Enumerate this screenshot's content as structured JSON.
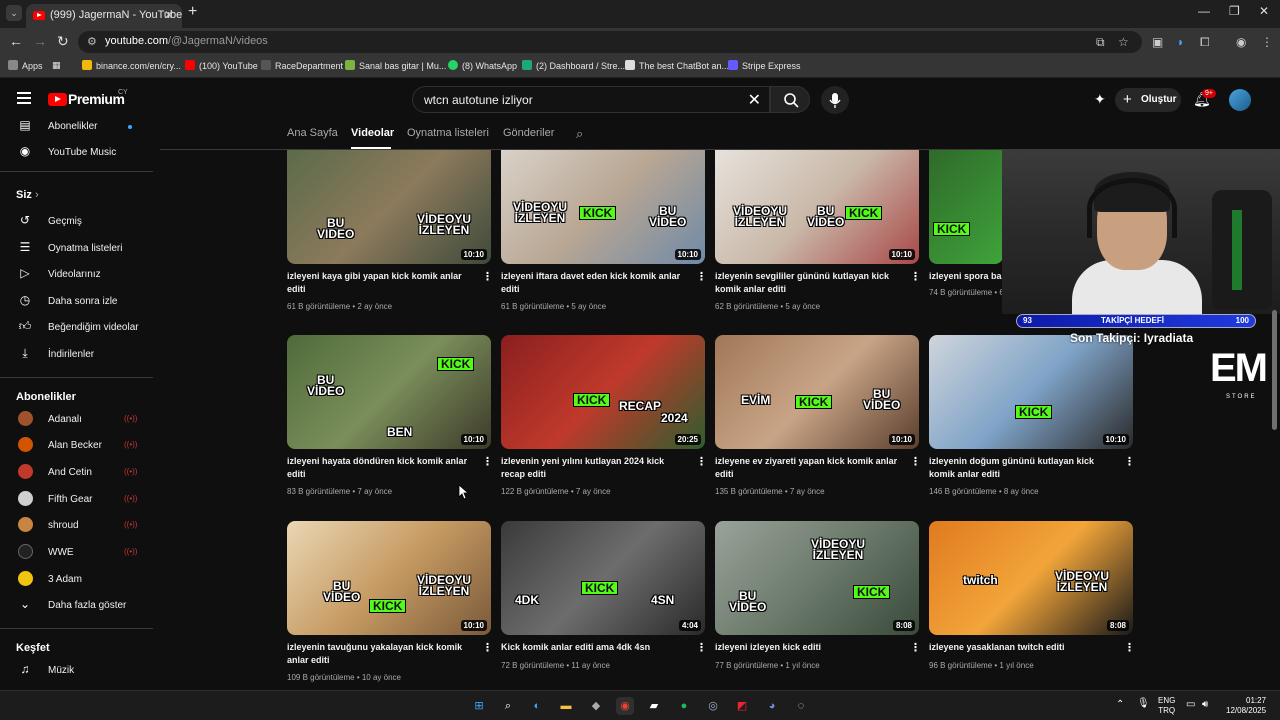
{
  "browser": {
    "tab_title": "(999) JagermaN - YouTube",
    "url_host": "youtube.com",
    "url_path": "/@JagermaN/videos",
    "bookmarks": [
      {
        "label": "Apps",
        "color": "#888888"
      },
      {
        "label": "binance.com/en/cry...",
        "color": "#f0b90b"
      },
      {
        "label": "(100) YouTube",
        "color": "#ff0000"
      },
      {
        "label": "RaceDepartment",
        "color": "#555555"
      },
      {
        "label": "Sanal bas gitar | Mu...",
        "color": "#7cb342"
      },
      {
        "label": "(8) WhatsApp",
        "color": "#25d366"
      },
      {
        "label": "(2) Dashboard / Stre...",
        "color": "#1fa67a"
      },
      {
        "label": "The best ChatBot an...",
        "color": "#dddddd"
      },
      {
        "label": "Stripe Express",
        "color": "#635bff"
      }
    ]
  },
  "yt": {
    "brand": "Premium",
    "country": "CY",
    "search_query": "wtcn autotune izliyor",
    "create_label": "Oluştur",
    "notif_count": "9+"
  },
  "sidebar": {
    "top": [
      {
        "label": "Abonelikler",
        "icon": "subscriptions-icon"
      },
      {
        "label": "YouTube Music",
        "icon": "music-icon"
      }
    ],
    "you_heading": "Siz",
    "you_items": [
      {
        "label": "Geçmiş",
        "icon": "history-icon"
      },
      {
        "label": "Oynatma listeleri",
        "icon": "playlists-icon"
      },
      {
        "label": "Videolarınız",
        "icon": "your-videos-icon"
      },
      {
        "label": "Daha sonra izle",
        "icon": "watch-later-icon"
      },
      {
        "label": "Beğendiğim videolar",
        "icon": "liked-icon"
      },
      {
        "label": "İndirilenler",
        "icon": "download-icon"
      }
    ],
    "subs_heading": "Abonelikler",
    "subs": [
      {
        "label": "Adanalı",
        "color": "#a0522d",
        "live": true
      },
      {
        "label": "Alan Becker",
        "color": "#d35400",
        "live": true
      },
      {
        "label": "And Cetin",
        "color": "#c0392b",
        "live": true
      },
      {
        "label": "Fifth Gear",
        "color": "#cfcfcf",
        "live": true
      },
      {
        "label": "shroud",
        "color": "#c68642",
        "live": true
      },
      {
        "label": "WWE",
        "color": "#222222",
        "live": true
      },
      {
        "label": "3 Adam",
        "color": "#f1c40f",
        "live": false
      }
    ],
    "show_more": "Daha fazla göster",
    "explore_heading": "Keşfet",
    "explore_items": [
      {
        "label": "Müzik",
        "icon": "music-note-icon"
      }
    ]
  },
  "channel_tabs": [
    "Ana Sayfa",
    "Videolar",
    "Oynatma listeleri",
    "Gönderiler"
  ],
  "videos": [
    {
      "title": "izleyeni kaya gibi yapan kick komik anlar editi",
      "views": "61 B görüntüleme",
      "age": "2 ay önce",
      "duration": "10:10",
      "bg": "linear-gradient(135deg,#5b6b4a,#8c7a5c 50%,#3e4a3a)"
    },
    {
      "title": "izleyeni iftara davet eden kick komik anlar editi",
      "views": "61 B görüntüleme",
      "age": "5 ay önce",
      "duration": "10:10",
      "bg": "linear-gradient(135deg,#d9d2c9,#b8a693 50%,#6f8aa8)"
    },
    {
      "title": "izleyenin sevgililer gününü kutlayan kick komik anlar editi",
      "views": "62 B görüntüleme",
      "age": "5 ay önce",
      "duration": "10:10",
      "bg": "linear-gradient(135deg,#e6e2dc,#c9b8a8 50%,#a84848)"
    },
    {
      "title": "izleyeni spora baş",
      "views": "74 B görüntüleme",
      "age": "6",
      "duration": "",
      "bg": "linear-gradient(135deg,#2f6a2a,#3fa33a)"
    },
    {
      "title": "izleyeni hayata döndüren kick komik anlar editi",
      "views": "83 B görüntüleme",
      "age": "7 ay önce",
      "duration": "10:10",
      "bg": "linear-gradient(135deg,#4f6b3a,#7a8e5a 50%,#3d3a2a)"
    },
    {
      "title": "izlevenin yeni yılını kutlayan 2024 kick recap editi",
      "views": "122 B görüntüleme",
      "age": "7 ay önce",
      "duration": "20:25",
      "bg": "linear-gradient(135deg,#8a1f1f,#c0392b 50%,#2e5d2e)"
    },
    {
      "title": "izleyene ev ziyareti yapan kick komik anlar editi",
      "views": "135 B görüntüleme",
      "age": "7 ay önce",
      "duration": "10:10",
      "bg": "linear-gradient(135deg,#a07858,#c8a486 50%,#5a3e2e)"
    },
    {
      "title": "izleyenin doğum gününü kutlayan kick komik anlar editi",
      "views": "146 B görüntüleme",
      "age": "8 ay önce",
      "duration": "10:10",
      "bg": "linear-gradient(135deg,#cfd5dc,#7fa3c7 50%,#2a2a2a)"
    },
    {
      "title": "izleyenin tavuğunu yakalayan kick komik anlar editi",
      "views": "109 B görüntüleme",
      "age": "10 ay önce",
      "duration": "10:10",
      "bg": "linear-gradient(135deg,#e9d7b4,#c69a62 50%,#7a5a3a)"
    },
    {
      "title": "Kick komik anlar editi ama 4dk 4sn",
      "views": "72 B görüntüleme",
      "age": "11 ay önce",
      "duration": "4:04",
      "bg": "linear-gradient(135deg,#3a3a3a,#6d6d6d 50%,#2a2a2a)"
    },
    {
      "title": "izleyeni izleyen kick editi",
      "views": "77 B görüntüleme",
      "age": "1 yıl önce",
      "duration": "8:08",
      "bg": "linear-gradient(135deg,#9aa39a,#6b7a6b 50%,#3a4a3a)"
    },
    {
      "title": "izleyene yasaklanan twitch editi",
      "views": "96 B görüntüleme",
      "age": "1 yıl önce",
      "duration": "8:08",
      "bg": "linear-gradient(135deg,#e07a1f,#f2a53a 50%,#1a1a1a)"
    }
  ],
  "overlay": {
    "follow_start": "93",
    "follow_label": "TAKİPÇİ HEDEFİ",
    "follow_end": "100",
    "last_follower": "Son Takipçi: Iyradiata",
    "logo_big": "EM",
    "logo_small": "STORE"
  },
  "tray": {
    "lang": "ENG",
    "region": "TRQ",
    "time": "01:27",
    "date": "12/08/2025"
  }
}
